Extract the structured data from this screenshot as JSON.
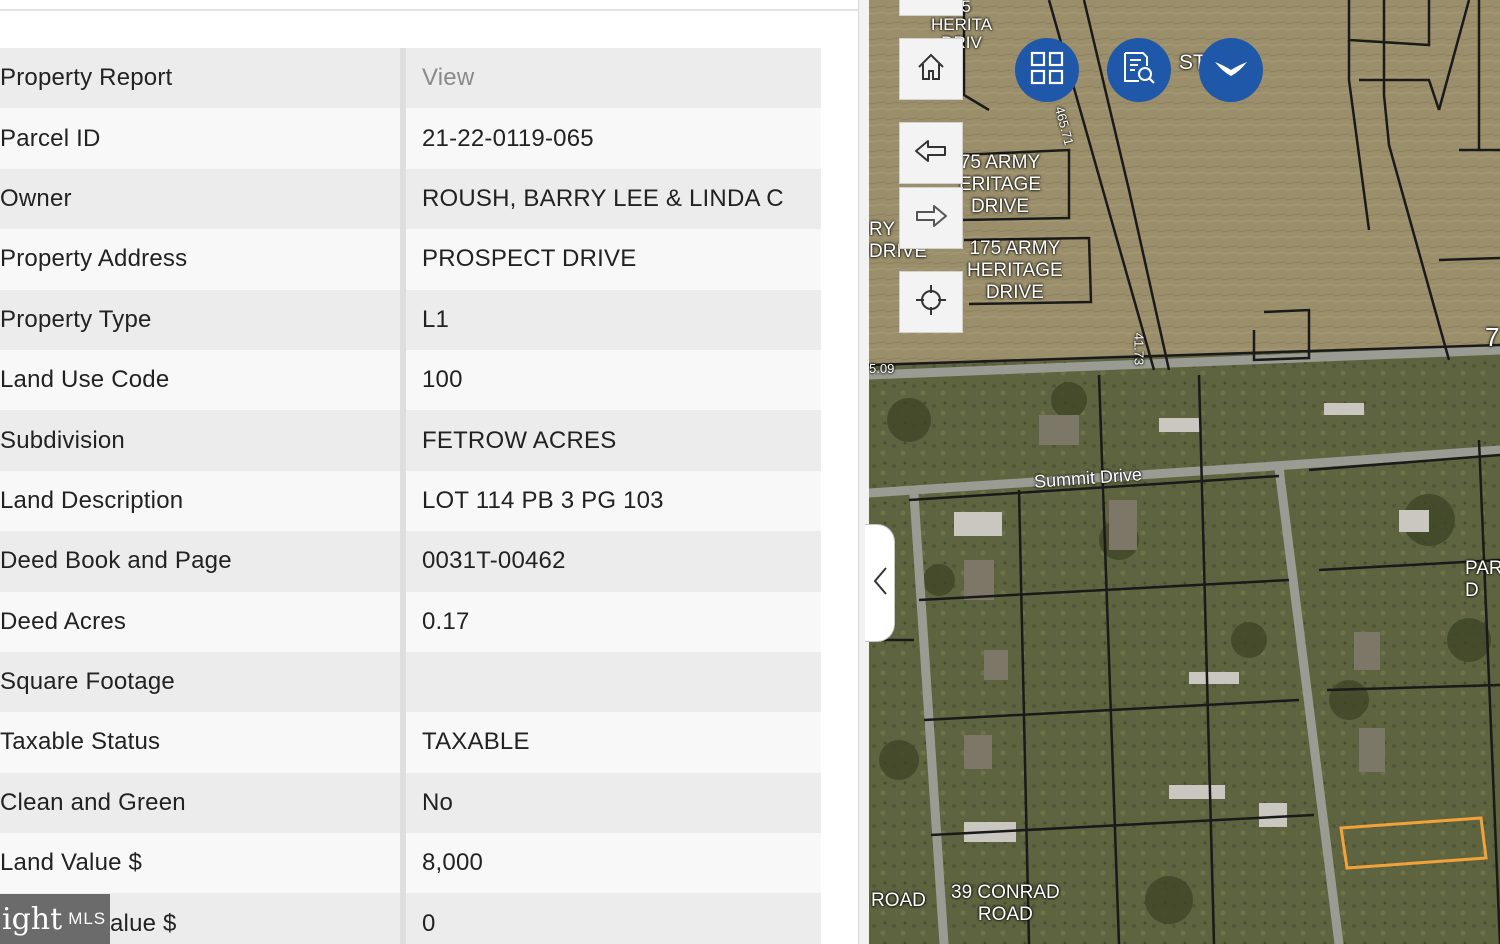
{
  "report": {
    "rows": [
      {
        "label": "Property Report",
        "value": "View"
      },
      {
        "label": "Parcel ID",
        "value": "21-22-0119-065"
      },
      {
        "label": "Owner",
        "value": "ROUSH, BARRY LEE & LINDA C"
      },
      {
        "label": "Property Address",
        "value": "PROSPECT DRIVE"
      },
      {
        "label": "Property Type",
        "value": "L1"
      },
      {
        "label": "Land Use Code",
        "value": "100"
      },
      {
        "label": "Subdivision",
        "value": "FETROW ACRES"
      },
      {
        "label": "Land Description",
        "value": "LOT 114 PB 3 PG 103"
      },
      {
        "label": "Deed Book and Page",
        "value": "0031T-00462"
      },
      {
        "label": "Deed Acres",
        "value": "0.17"
      },
      {
        "label": "Square Footage",
        "value": ""
      },
      {
        "label": "Taxable Status",
        "value": "TAXABLE"
      },
      {
        "label": "Clean and Green",
        "value": "No"
      },
      {
        "label": "Land Value $",
        "value": "8,000"
      },
      {
        "label": "alue $",
        "value": "0"
      }
    ]
  },
  "watermark": {
    "main": "ight",
    "sub": "MLS"
  },
  "map": {
    "labels": {
      "army_75": "75 ARMY\nERITAGE\nDRIVE",
      "army_175": "175 ARMY\nHERITAGE\nDRIVE",
      "ry_drive": "RY\nDRIVE",
      "heritage_top": "75\nHERITA\nDRIV",
      "summit": "Summit Drive",
      "conrad": "39 CONRAD\nROAD",
      "road": "ROAD",
      "par": "PAR\nD",
      "st": "ST",
      "seven": "7",
      "dim_465": "465.71",
      "dim_4173": "41.73",
      "dim_509": "5.09"
    }
  },
  "toolbar": {
    "home": "home-icon",
    "back": "back-arrow-icon",
    "forward": "forward-arrow-icon",
    "locate": "locate-icon",
    "basemap": "grid-icon",
    "identify": "report-search-icon",
    "app": "bird-icon"
  },
  "colors": {
    "accent": "#1f58a8",
    "odd_row": "#ececec",
    "even_row": "#f8f8f8"
  }
}
